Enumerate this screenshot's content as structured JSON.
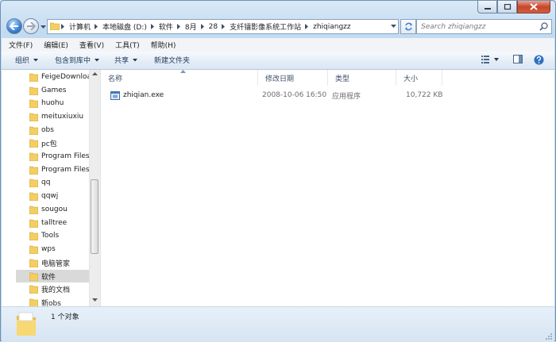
{
  "window": {
    "caption_buttons": [
      "minimize",
      "maximize",
      "close"
    ]
  },
  "address_bar": {
    "breadcrumbs": [
      "计算机",
      "本地磁盘 (D:)",
      "软件",
      "8月",
      "28",
      "支纤镭影像系统工作站",
      "zhiqiangzz"
    ]
  },
  "search": {
    "placeholder": "Search zhiqiangzz"
  },
  "menubar": {
    "items": [
      "文件(F)",
      "编辑(E)",
      "查看(V)",
      "工具(T)",
      "帮助(H)"
    ]
  },
  "toolbar": {
    "organize": "组织",
    "include_in_library": "包含到库中",
    "share": "共享",
    "new_folder": "新建文件夹"
  },
  "tree": {
    "items": [
      "FeigeDownloa",
      "Games",
      "huohu",
      "meituxiuxiu",
      "obs",
      "pc包",
      "Program Files",
      "Program Files",
      "qq",
      "qqwj",
      "sougou",
      "talltree",
      "Tools",
      "wps",
      "电脑管家",
      "软件",
      "我的文档",
      "新obs"
    ],
    "selected": "软件"
  },
  "columns": {
    "name": "名称",
    "modified": "修改日期",
    "type": "类型",
    "size": "大小"
  },
  "files": [
    {
      "name": "zhiqian.exe",
      "modified": "2008-10-06 16:50",
      "type": "应用程序",
      "size": "10,722 KB",
      "icon": "exe-icon"
    }
  ],
  "status": {
    "count": "1 个对象"
  },
  "colors": {
    "frame": "#c3dbf0",
    "folder": "#f3cf63",
    "selected_row": "#d9d9d9"
  }
}
